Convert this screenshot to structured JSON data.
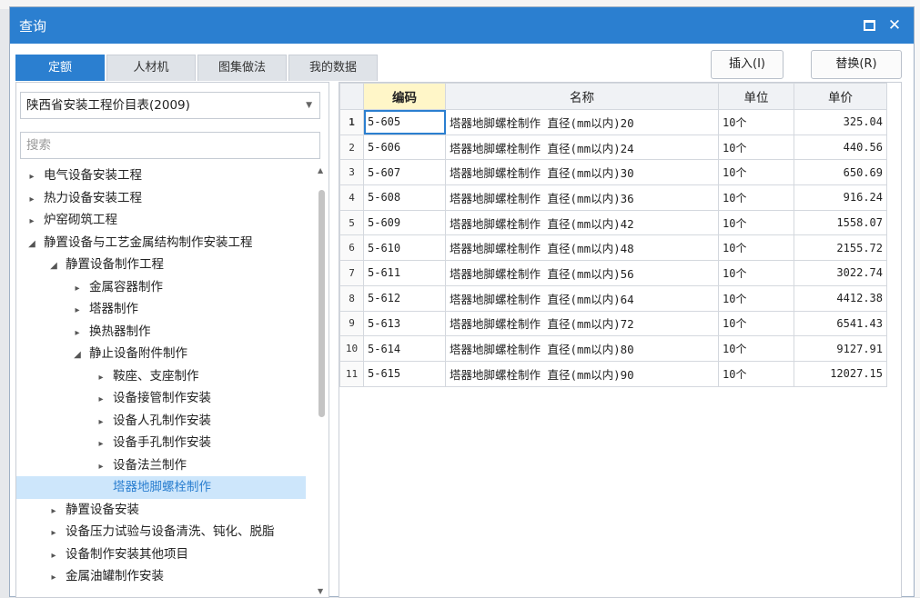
{
  "dialog": {
    "title": "查询"
  },
  "tabs": [
    {
      "label": "定额",
      "active": true
    },
    {
      "label": "人材机",
      "active": false
    },
    {
      "label": "图集做法",
      "active": false
    },
    {
      "label": "我的数据",
      "active": false
    }
  ],
  "actions": {
    "insert_label": "插入(I)",
    "replace_label": "替换(R)"
  },
  "library": {
    "selected": "陕西省安装工程价目表(2009)"
  },
  "search": {
    "placeholder": "搜索"
  },
  "tree": [
    {
      "label": "电气设备安装工程",
      "level": 0,
      "arrow": "▸"
    },
    {
      "label": "热力设备安装工程",
      "level": 0,
      "arrow": "▸"
    },
    {
      "label": "炉窑砌筑工程",
      "level": 0,
      "arrow": "▸"
    },
    {
      "label": "静置设备与工艺金属结构制作安装工程",
      "level": 0,
      "arrow": "◢"
    },
    {
      "label": "静置设备制作工程",
      "level": 1,
      "arrow": "◢"
    },
    {
      "label": "金属容器制作",
      "level": 2,
      "arrow": "▸"
    },
    {
      "label": "塔器制作",
      "level": 2,
      "arrow": "▸"
    },
    {
      "label": "换热器制作",
      "level": 2,
      "arrow": "▸"
    },
    {
      "label": "静止设备附件制作",
      "level": 2,
      "arrow": "◢"
    },
    {
      "label": "鞍座、支座制作",
      "level": 3,
      "arrow": "▸"
    },
    {
      "label": "设备接管制作安装",
      "level": 3,
      "arrow": "▸"
    },
    {
      "label": "设备人孔制作安装",
      "level": 3,
      "arrow": "▸"
    },
    {
      "label": "设备手孔制作安装",
      "level": 3,
      "arrow": "▸"
    },
    {
      "label": "设备法兰制作",
      "level": 3,
      "arrow": "▸"
    },
    {
      "label": "塔器地脚螺栓制作",
      "level": 3,
      "arrow": "",
      "selected": true
    },
    {
      "label": "静置设备安装",
      "level": 1,
      "arrow": "▸"
    },
    {
      "label": "设备压力试验与设备清洗、钝化、脱脂",
      "level": 1,
      "arrow": "▸"
    },
    {
      "label": "设备制作安装其他项目",
      "level": 1,
      "arrow": "▸"
    },
    {
      "label": "金属油罐制作安装",
      "level": 1,
      "arrow": "▸"
    }
  ],
  "grid": {
    "columns": [
      "编码",
      "名称",
      "单位",
      "单价"
    ],
    "rows": [
      {
        "no": "1",
        "code": "5-605",
        "name": "塔器地脚螺栓制作 直径(mm以内)20",
        "unit": "10个",
        "price": "325.04"
      },
      {
        "no": "2",
        "code": "5-606",
        "name": "塔器地脚螺栓制作 直径(mm以内)24",
        "unit": "10个",
        "price": "440.56"
      },
      {
        "no": "3",
        "code": "5-607",
        "name": "塔器地脚螺栓制作 直径(mm以内)30",
        "unit": "10个",
        "price": "650.69"
      },
      {
        "no": "4",
        "code": "5-608",
        "name": "塔器地脚螺栓制作 直径(mm以内)36",
        "unit": "10个",
        "price": "916.24"
      },
      {
        "no": "5",
        "code": "5-609",
        "name": "塔器地脚螺栓制作 直径(mm以内)42",
        "unit": "10个",
        "price": "1558.07"
      },
      {
        "no": "6",
        "code": "5-610",
        "name": "塔器地脚螺栓制作 直径(mm以内)48",
        "unit": "10个",
        "price": "2155.72"
      },
      {
        "no": "7",
        "code": "5-611",
        "name": "塔器地脚螺栓制作 直径(mm以内)56",
        "unit": "10个",
        "price": "3022.74"
      },
      {
        "no": "8",
        "code": "5-612",
        "name": "塔器地脚螺栓制作 直径(mm以内)64",
        "unit": "10个",
        "price": "4412.38"
      },
      {
        "no": "9",
        "code": "5-613",
        "name": "塔器地脚螺栓制作 直径(mm以内)72",
        "unit": "10个",
        "price": "6541.43"
      },
      {
        "no": "10",
        "code": "5-614",
        "name": "塔器地脚螺栓制作 直径(mm以内)80",
        "unit": "10个",
        "price": "9127.91"
      },
      {
        "no": "11",
        "code": "5-615",
        "name": "塔器地脚螺栓制作 直径(mm以内)90",
        "unit": "10个",
        "price": "12027.15"
      }
    ]
  },
  "colors": {
    "accent": "#2b7fd0",
    "selected_bg": "#cde6fb",
    "code_header_bg": "#fff6c8"
  }
}
